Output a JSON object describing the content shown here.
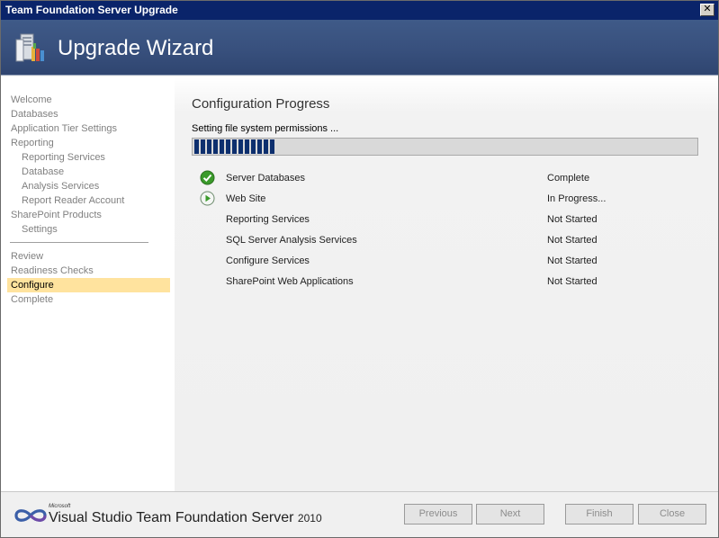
{
  "window": {
    "title": "Team Foundation Server Upgrade",
    "close_glyph": "✕"
  },
  "header": {
    "title": "Upgrade Wizard",
    "icon": "server-wizard-icon"
  },
  "sidebar": {
    "items": [
      {
        "label": "Welcome"
      },
      {
        "label": "Databases"
      },
      {
        "label": "Application Tier Settings"
      },
      {
        "label": "Reporting"
      },
      {
        "label": "Reporting Services"
      },
      {
        "label": "Database"
      },
      {
        "label": "Analysis Services"
      },
      {
        "label": "Report Reader Account"
      },
      {
        "label": "SharePoint Products"
      },
      {
        "label": "Settings"
      },
      {
        "label": "Review"
      },
      {
        "label": "Readiness Checks"
      },
      {
        "label": "Configure"
      },
      {
        "label": "Complete"
      }
    ],
    "active": "Configure"
  },
  "main": {
    "title": "Configuration Progress",
    "status": "Setting file system permissions ...",
    "progress_fraction": 0.16,
    "tasks": [
      {
        "name": "Server Databases",
        "status": "Complete",
        "icon": "check-circle-icon"
      },
      {
        "name": "Web Site",
        "status": "In Progress...",
        "icon": "play-circle-icon"
      },
      {
        "name": "Reporting Services",
        "status": "Not Started",
        "icon": ""
      },
      {
        "name": "SQL Server Analysis Services",
        "status": "Not Started",
        "icon": ""
      },
      {
        "name": "Configure Services",
        "status": "Not Started",
        "icon": ""
      },
      {
        "name": "SharePoint Web Applications",
        "status": "Not Started",
        "icon": ""
      }
    ]
  },
  "footer": {
    "brand_ms": "Microsoft",
    "brand_name": "Visual Studio Team Foundation Server",
    "brand_year": "2010",
    "buttons": {
      "previous": "Previous",
      "next": "Next",
      "finish": "Finish",
      "close": "Close"
    }
  },
  "colors": {
    "header_bg": "#38507d",
    "titlebar_bg": "#0a246a",
    "active_item_bg": "#ffe39e",
    "progress_fill": "#0d2f6e",
    "check_green": "#3a9a2a"
  }
}
